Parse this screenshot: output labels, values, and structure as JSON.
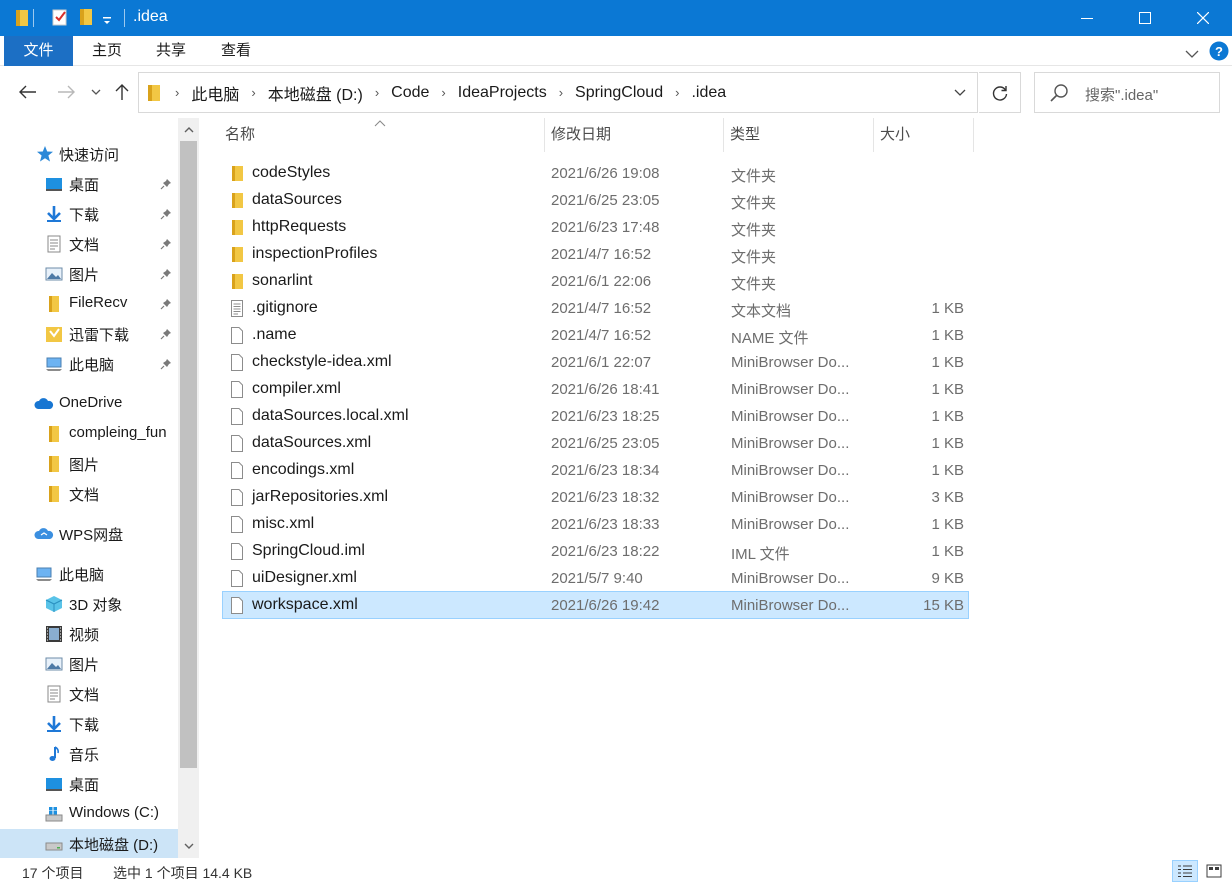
{
  "window": {
    "title": ".idea",
    "colors": {
      "titlebar": "#0b78d4",
      "file_tab": "#1c6fc4",
      "selection": "#cce8ff",
      "folder": "#f2c744"
    }
  },
  "ribbon": {
    "tabs": [
      {
        "label": "文件"
      },
      {
        "label": "主页"
      },
      {
        "label": "共享"
      },
      {
        "label": "查看"
      }
    ]
  },
  "address": {
    "crumbs": [
      "此电脑",
      "本地磁盘 (D:)",
      "Code",
      "IdeaProjects",
      "SpringCloud",
      ".idea"
    ],
    "search_placeholder": "搜索\".idea\""
  },
  "navpane": {
    "items": [
      {
        "label": "快速访问",
        "icon": "star-icon"
      },
      {
        "label": "桌面",
        "icon": "desktop-icon",
        "pinned": true
      },
      {
        "label": "下载",
        "icon": "download-icon",
        "pinned": true
      },
      {
        "label": "文档",
        "icon": "document-icon",
        "pinned": true
      },
      {
        "label": "图片",
        "icon": "pictures-icon",
        "pinned": true
      },
      {
        "label": "FileRecv",
        "icon": "folder-icon",
        "pinned": true
      },
      {
        "label": "迅雷下载",
        "icon": "thunder-folder-icon",
        "pinned": true
      },
      {
        "label": "此电脑",
        "icon": "computer-icon",
        "pinned": true
      },
      {
        "label": "OneDrive",
        "icon": "cloud-icon"
      },
      {
        "label": "compleing_fun",
        "icon": "folder-icon"
      },
      {
        "label": "图片",
        "icon": "folder-icon"
      },
      {
        "label": "文档",
        "icon": "folder-icon"
      },
      {
        "label": "WPS网盘",
        "icon": "wps-cloud-icon"
      },
      {
        "label": "此电脑",
        "icon": "computer-icon"
      },
      {
        "label": "3D 对象",
        "icon": "3d-objects-icon"
      },
      {
        "label": "视频",
        "icon": "video-icon"
      },
      {
        "label": "图片",
        "icon": "pictures-icon"
      },
      {
        "label": "文档",
        "icon": "document-icon"
      },
      {
        "label": "下载",
        "icon": "download-icon"
      },
      {
        "label": "音乐",
        "icon": "music-icon"
      },
      {
        "label": "桌面",
        "icon": "desktop-icon"
      },
      {
        "label": "Windows (C:)",
        "icon": "drive-windows-icon"
      },
      {
        "label": "本地磁盘 (D:)",
        "icon": "drive-icon",
        "selected": true
      }
    ]
  },
  "filelist": {
    "headers": {
      "name": "名称",
      "date": "修改日期",
      "type": "类型",
      "size": "大小"
    },
    "files": [
      {
        "name": "codeStyles",
        "date": "2021/6/26 19:08",
        "type": "文件夹",
        "size": "",
        "kind": "folder"
      },
      {
        "name": "dataSources",
        "date": "2021/6/25 23:05",
        "type": "文件夹",
        "size": "",
        "kind": "folder"
      },
      {
        "name": "httpRequests",
        "date": "2021/6/23 17:48",
        "type": "文件夹",
        "size": "",
        "kind": "folder"
      },
      {
        "name": "inspectionProfiles",
        "date": "2021/4/7 16:52",
        "type": "文件夹",
        "size": "",
        "kind": "folder"
      },
      {
        "name": "sonarlint",
        "date": "2021/6/1 22:06",
        "type": "文件夹",
        "size": "",
        "kind": "folder"
      },
      {
        "name": ".gitignore",
        "date": "2021/4/7 16:52",
        "type": "文本文档",
        "size": "1 KB",
        "kind": "text"
      },
      {
        "name": ".name",
        "date": "2021/4/7 16:52",
        "type": "NAME 文件",
        "size": "1 KB",
        "kind": "file"
      },
      {
        "name": "checkstyle-idea.xml",
        "date": "2021/6/1 22:07",
        "type": "MiniBrowser Do...",
        "size": "1 KB",
        "kind": "file"
      },
      {
        "name": "compiler.xml",
        "date": "2021/6/26 18:41",
        "type": "MiniBrowser Do...",
        "size": "1 KB",
        "kind": "file"
      },
      {
        "name": "dataSources.local.xml",
        "date": "2021/6/23 18:25",
        "type": "MiniBrowser Do...",
        "size": "1 KB",
        "kind": "file"
      },
      {
        "name": "dataSources.xml",
        "date": "2021/6/25 23:05",
        "type": "MiniBrowser Do...",
        "size": "1 KB",
        "kind": "file"
      },
      {
        "name": "encodings.xml",
        "date": "2021/6/23 18:34",
        "type": "MiniBrowser Do...",
        "size": "1 KB",
        "kind": "file"
      },
      {
        "name": "jarRepositories.xml",
        "date": "2021/6/23 18:32",
        "type": "MiniBrowser Do...",
        "size": "3 KB",
        "kind": "file"
      },
      {
        "name": "misc.xml",
        "date": "2021/6/23 18:33",
        "type": "MiniBrowser Do...",
        "size": "1 KB",
        "kind": "file"
      },
      {
        "name": "SpringCloud.iml",
        "date": "2021/6/23 18:22",
        "type": "IML 文件",
        "size": "1 KB",
        "kind": "file"
      },
      {
        "name": "uiDesigner.xml",
        "date": "2021/5/7 9:40",
        "type": "MiniBrowser Do...",
        "size": "9 KB",
        "kind": "file"
      },
      {
        "name": "workspace.xml",
        "date": "2021/6/26 19:42",
        "type": "MiniBrowser Do...",
        "size": "15 KB",
        "kind": "file",
        "selected": true
      }
    ]
  },
  "status": {
    "count": "17 个项目",
    "selection": "选中 1 个项目  14.4 KB"
  }
}
